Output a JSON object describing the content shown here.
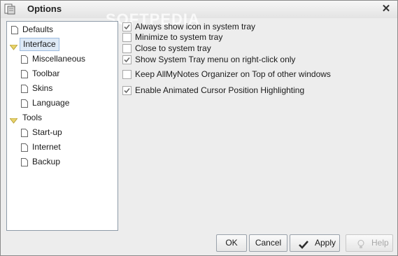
{
  "window": {
    "title": "Options"
  },
  "watermark": "SOFTPEDIA",
  "tree": {
    "items": [
      {
        "label": "Defaults"
      },
      {
        "label": "Interface"
      },
      {
        "label": "Miscellaneous"
      },
      {
        "label": "Toolbar"
      },
      {
        "label": "Skins"
      },
      {
        "label": "Language"
      },
      {
        "label": "Tools"
      },
      {
        "label": "Start-up"
      },
      {
        "label": "Internet"
      },
      {
        "label": "Backup"
      }
    ],
    "selected": "Interface"
  },
  "options": [
    {
      "label": "Always show icon in system tray",
      "checked": true
    },
    {
      "label": "Minimize to system tray",
      "checked": false
    },
    {
      "label": "Close to system tray",
      "checked": false
    },
    {
      "label": "Show System Tray menu on right-click only",
      "checked": true
    },
    {
      "label": "Keep AllMyNotes Organizer on Top of other windows",
      "checked": false
    },
    {
      "label": "Enable Animated Cursor Position Highlighting",
      "checked": true
    }
  ],
  "buttons": {
    "ok": "OK",
    "cancel": "Cancel",
    "apply": "Apply",
    "help": "Help"
  },
  "colors": {
    "selection_bg": "#dde9f6",
    "folder_yellow": "#e8d36a",
    "checkmark": "#6b6b6b"
  },
  "icons": {
    "close": "close-icon",
    "document": "document-icon",
    "expanded": "triangle-down-icon",
    "apply": "checkmark-icon",
    "help": "help-bulb-icon"
  }
}
